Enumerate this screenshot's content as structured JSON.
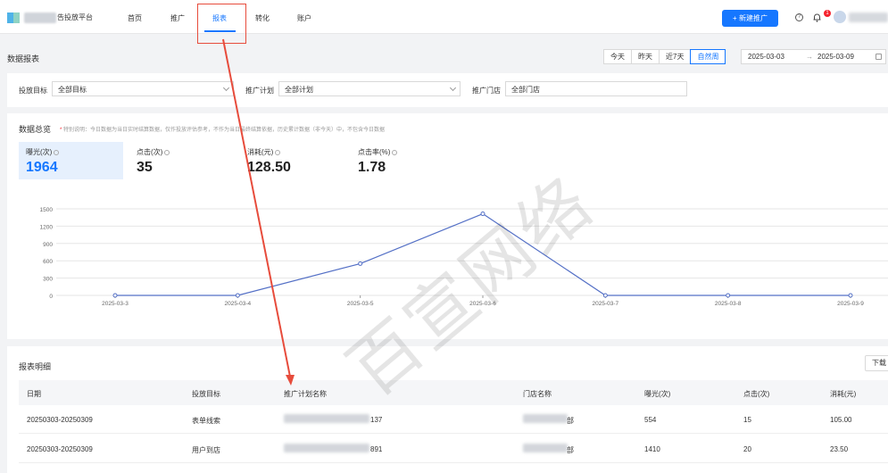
{
  "nav": {
    "brand": "告投放平台",
    "items": [
      "首页",
      "推广",
      "报表",
      "转化",
      "账户"
    ],
    "new_button": "+ 新建推广",
    "help_icon": "help-icon",
    "notif_count": "1"
  },
  "page": {
    "title": "数据报表",
    "date_buttons": [
      "今天",
      "昨天",
      "近7天",
      "自然周"
    ],
    "active_date_button": "自然周",
    "range_start": "2025-03-03",
    "range_sep": "→",
    "range_end": "2025-03-09"
  },
  "filters": [
    {
      "label": "投放目标",
      "value": "全部目标"
    },
    {
      "label": "推广计划",
      "value": "全部计划"
    },
    {
      "label": "推广门店",
      "value": "全部门店"
    }
  ],
  "overview": {
    "title": "数据总览",
    "note_star": "*",
    "note": "特别说明：今日数据为当日实时结算数据，仅作投放评估参考，不作为当日最终结算依据，历史累计数据（非今天）中，不包含今日数据",
    "metrics": [
      {
        "label": "曝光(次)",
        "value": "1964"
      },
      {
        "label": "点击(次)",
        "value": "35"
      },
      {
        "label": "消耗(元)",
        "value": "128.50"
      },
      {
        "label": "点击率(%)",
        "value": "1.78"
      }
    ]
  },
  "chart_data": {
    "type": "line",
    "title": "",
    "xlabel": "",
    "ylabel": "",
    "x": [
      "2025-03-3",
      "2025-03-4",
      "2025-03-5",
      "2025-03-6",
      "2025-03-7",
      "2025-03-8",
      "2025-03-9"
    ],
    "series": [
      {
        "values": [
          0,
          0,
          550,
          1414,
          0,
          0,
          0
        ]
      }
    ],
    "ylim": [
      0,
      1500
    ],
    "yticks": [
      0,
      300,
      600,
      900,
      1200,
      1500
    ],
    "grid": true,
    "color": "#5470c6"
  },
  "detail": {
    "title": "报表明细",
    "download_button": "下载",
    "columns": [
      "日期",
      "投放目标",
      "推广计划名称",
      "门店名称",
      "曝光(次)",
      "点击(次)",
      "消耗(元)"
    ],
    "rows": [
      {
        "date": "20250303-20250309",
        "goal": "表单线索",
        "plan_suffix": "137",
        "store_suffix": "部",
        "exposure": "554",
        "clicks": "15",
        "cost": "105.00"
      },
      {
        "date": "20250303-20250309",
        "goal": "用户到店",
        "plan_suffix": "891",
        "store_suffix": "部",
        "exposure": "1410",
        "clicks": "20",
        "cost": "23.50"
      }
    ]
  },
  "watermark": "百宣网络"
}
